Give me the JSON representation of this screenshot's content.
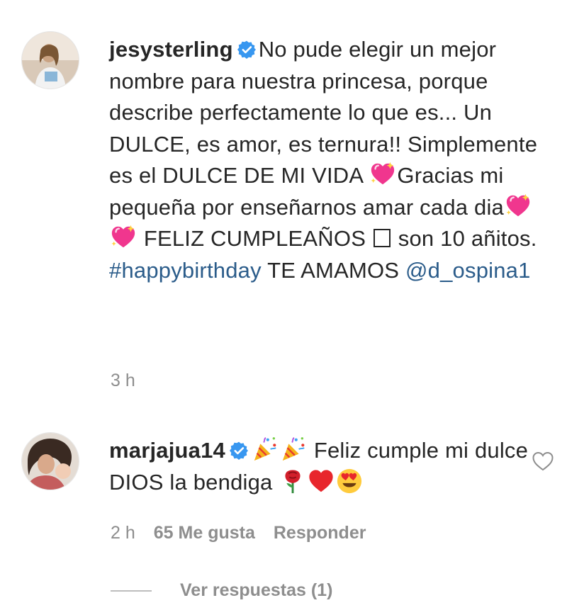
{
  "comments": [
    {
      "username": "jesysterling",
      "verified": true,
      "text": {
        "p1": "No pude elegir un mejor nombre para nuestra princesa, porque describe perfectamente lo que es... Un DULCE, es amor, es ternura!! Simplemente es el DULCE DE MI VIDA",
        "p2": "Gracias mi pequeña por enseñarnos amar cada dia",
        "p3": "FELIZ CUMPLEAÑOS",
        "p4": "son 10 añitos.",
        "hashtag": "#happybirthday",
        "p5": "TE AMAMOS",
        "mention": "@d_ospina1"
      },
      "time": "3 h"
    },
    {
      "username": "marjajua14",
      "verified": true,
      "text": {
        "p1": "Feliz cumple mi dulce DIOS la bendiga"
      },
      "time": "2 h",
      "likes": "65 Me gusta",
      "reply_label": "Responder",
      "view_replies": "Ver respuestas (1)"
    }
  ],
  "colors": {
    "link": "#2b5c8a",
    "meta": "#8e8e8e",
    "verified": "#3897f0"
  },
  "icons": [
    "verified-badge-icon",
    "sparkling-heart-emoji",
    "party-popper-emoji",
    "rose-emoji",
    "red-heart-emoji",
    "heart-eyes-emoji",
    "heart-outline-icon"
  ]
}
